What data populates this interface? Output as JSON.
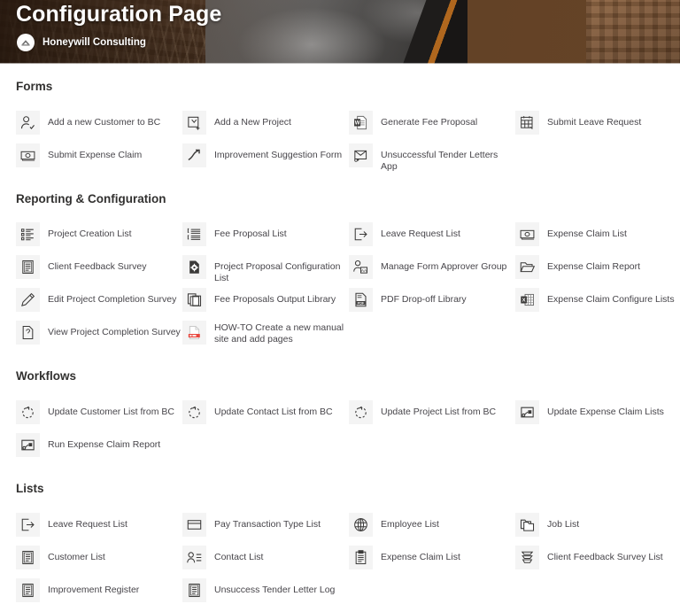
{
  "banner": {
    "title": "Configuration Page",
    "subtitle": "Honeywill Consulting",
    "logo_icon": "honeywill-logo-icon"
  },
  "sections": [
    {
      "id": "forms",
      "title": "Forms",
      "items": [
        {
          "label": "Add a new Customer to BC",
          "icon": "add-person-icon"
        },
        {
          "label": "Add a New Project",
          "icon": "add-folder-icon"
        },
        {
          "label": "Generate Fee Proposal",
          "icon": "word-document-icon"
        },
        {
          "label": "Submit Leave Request",
          "icon": "calendar-icon"
        },
        {
          "label": "Submit Expense Claim",
          "icon": "banknote-icon"
        },
        {
          "label": "Improvement Suggestion Form",
          "icon": "trend-up-icon"
        },
        {
          "label": "Unsuccessful Tender Letters App",
          "icon": "mail-icon"
        }
      ]
    },
    {
      "id": "reporting",
      "title": "Reporting & Configuration",
      "items": [
        {
          "label": "Project Creation List",
          "icon": "bulleted-list-icon"
        },
        {
          "label": "Fee Proposal List",
          "icon": "ordered-list-icon"
        },
        {
          "label": "Leave Request List",
          "icon": "exit-arrow-icon"
        },
        {
          "label": "Expense Claim List",
          "icon": "banknote-icon"
        },
        {
          "label": "Client Feedback Survey",
          "icon": "survey-document-icon"
        },
        {
          "label": "Project Proposal Configuration List",
          "icon": "document-gear-icon"
        },
        {
          "label": "Manage Form Approver Group",
          "icon": "person-group-icon"
        },
        {
          "label": "Expense Claim Report",
          "icon": "open-folder-icon"
        },
        {
          "label": "Edit Project Completion Survey",
          "icon": "pencil-icon"
        },
        {
          "label": "Fee Proposals Output Library",
          "icon": "copy-documents-icon"
        },
        {
          "label": "PDF Drop-off Library",
          "icon": "pdf-document-icon"
        },
        {
          "label": "Expense Claim Configure Lists",
          "icon": "excel-spreadsheet-icon"
        },
        {
          "label": "View Project Completion Survey",
          "icon": "question-document-icon"
        },
        {
          "label": "HOW-TO Create a new manual site and add pages",
          "icon": "pdf-file-red-icon"
        }
      ]
    },
    {
      "id": "workflows",
      "title": "Workflows",
      "items": [
        {
          "label": "Update Customer List from BC",
          "icon": "sync-dashed-icon"
        },
        {
          "label": "Update Contact List from BC",
          "icon": "sync-dashed-icon"
        },
        {
          "label": "Update Project List from BC",
          "icon": "sync-dashed-icon"
        },
        {
          "label": "Update Expense Claim Lists",
          "icon": "flow-action-icon"
        },
        {
          "label": "Run Expense Claim Report",
          "icon": "flow-action-icon"
        }
      ]
    },
    {
      "id": "lists",
      "title": "Lists",
      "items": [
        {
          "label": "Leave Request List",
          "icon": "exit-arrow-icon"
        },
        {
          "label": "Pay Transaction Type List",
          "icon": "card-icon"
        },
        {
          "label": "Employee List",
          "icon": "globe-icon"
        },
        {
          "label": "Job List",
          "icon": "folders-icon"
        },
        {
          "label": "Customer List",
          "icon": "list-document-icon"
        },
        {
          "label": "Contact List",
          "icon": "contact-card-icon"
        },
        {
          "label": "Expense Claim List",
          "icon": "clipboard-icon"
        },
        {
          "label": "Client Feedback Survey List",
          "icon": "stacked-layers-icon"
        },
        {
          "label": "Improvement Register",
          "icon": "list-document-icon"
        },
        {
          "label": "Unsuccess Tender Letter Log",
          "icon": "list-document-icon"
        }
      ]
    }
  ],
  "colors": {
    "label_text": "#47454a",
    "heading_text": "#323130",
    "tile_bg": "#f4f4f4",
    "banner_accent": "#c8741f"
  }
}
